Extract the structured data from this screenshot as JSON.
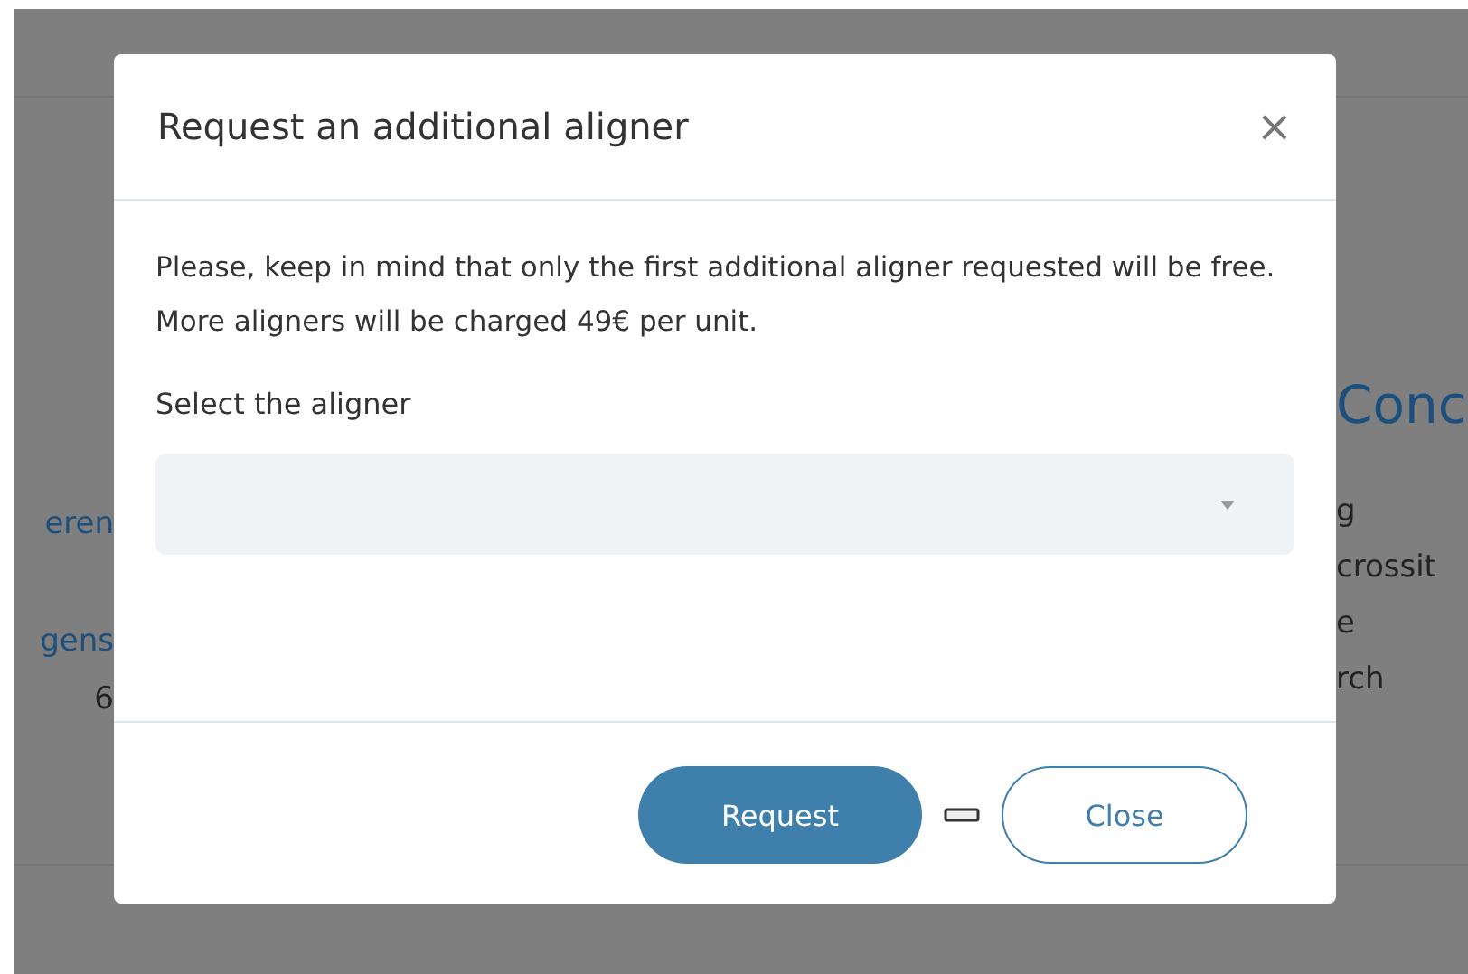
{
  "background": {
    "left_texts": [
      {
        "text": "eren",
        "kind": "link"
      },
      {
        "text": "gens",
        "kind": "link"
      },
      {
        "text": "6",
        "kind": "plain"
      }
    ],
    "heading": "Conc",
    "right_texts": [
      "g",
      "crossit",
      "e",
      "rch"
    ]
  },
  "dialog": {
    "title": "Request an additional aligner",
    "close": "×",
    "message": "Please, keep in mind that only the first additional aligner requested will be free. More aligners will be charged 49€ per unit.",
    "select_label": "Select the aligner",
    "buttons": [
      {
        "label": "Request",
        "kind": "primary"
      },
      {
        "label": "Close",
        "kind": "secondary"
      }
    ]
  }
}
